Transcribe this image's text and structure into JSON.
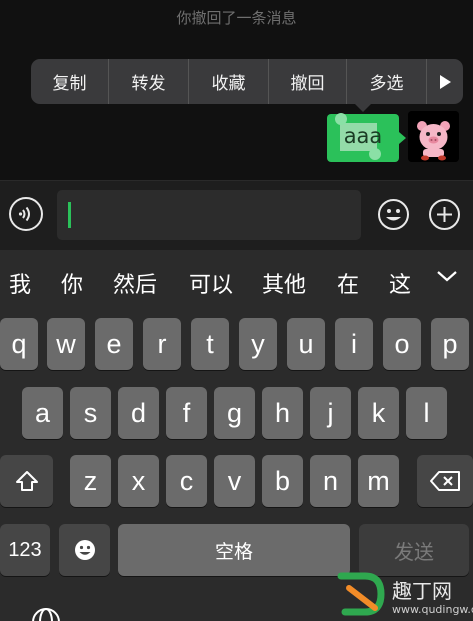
{
  "chat": {
    "recall_note": "你撤回了一条消息",
    "context_menu": [
      "复制",
      "转发",
      "收藏",
      "撤回",
      "多选"
    ],
    "message_text": "aaa"
  },
  "input_bar": {
    "value": ""
  },
  "candidates": [
    "我",
    "你",
    "然后",
    "可以",
    "其他",
    "在",
    "这"
  ],
  "keyboard": {
    "row1": [
      "q",
      "w",
      "e",
      "r",
      "t",
      "y",
      "u",
      "i",
      "o",
      "p"
    ],
    "row2": [
      "a",
      "s",
      "d",
      "f",
      "g",
      "h",
      "j",
      "k",
      "l"
    ],
    "row3": [
      "z",
      "x",
      "c",
      "v",
      "b",
      "n",
      "m"
    ],
    "numbers_label": "123",
    "space_label": "空格",
    "send_label": "发送"
  },
  "watermark": {
    "text": "趣丁网",
    "url": "www.qudingw.com"
  },
  "colors": {
    "accent_green": "#2bc15a",
    "key_bg": "#6b6b6b"
  }
}
